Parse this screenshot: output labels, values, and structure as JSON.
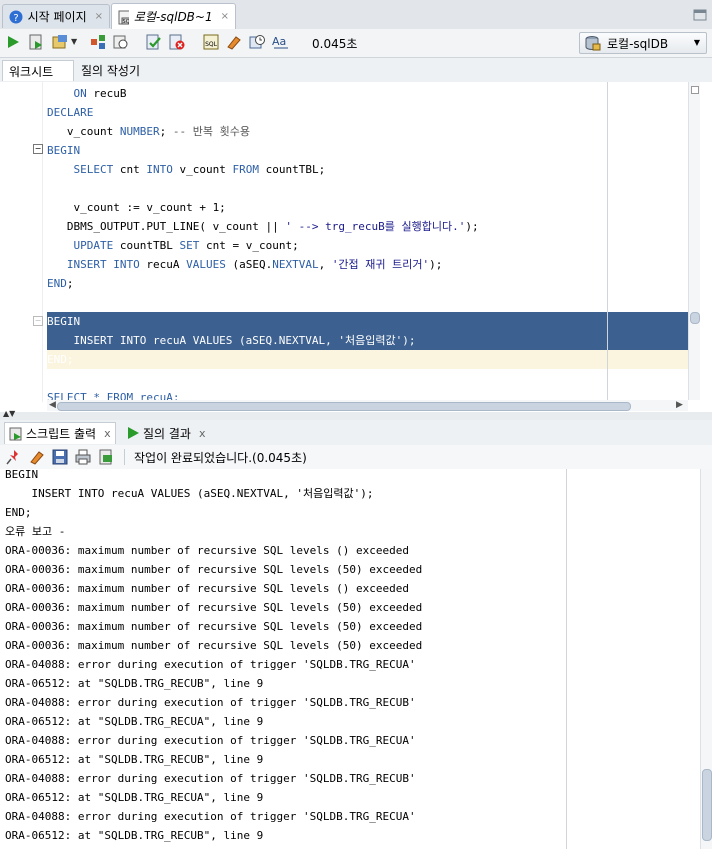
{
  "tabs": [
    {
      "label": "시작 페이지",
      "close": "×",
      "icon": "help-icon"
    },
    {
      "label": "로컬-sqlDB~1",
      "close": "×",
      "icon": "sql-worksheet-icon"
    }
  ],
  "toolbar": {
    "elapsed": "0.045초",
    "connection": "로컬-sqlDB",
    "icons": [
      "run-statement-icon",
      "run-script-icon",
      "autotrace-icon",
      "explain-plan-icon",
      "sql-tuning-icon",
      "commit-icon",
      "rollback-icon",
      "unshared-sql-icon",
      "clear-icon",
      "history-icon",
      "format-case-icon"
    ]
  },
  "worksheet_tabs": [
    "워크시트",
    "질의 작성기"
  ],
  "editor": {
    "lines": [
      [
        {
          "t": "    "
        },
        {
          "t": "ON",
          "c": "kw"
        },
        {
          "t": " recuB"
        }
      ],
      [
        {
          "t": "DECLARE",
          "c": "kw"
        }
      ],
      [
        {
          "t": "   v_count "
        },
        {
          "t": "NUMBER",
          "c": "kw"
        },
        {
          "t": "; "
        },
        {
          "t": "-- 반복 횟수용",
          "c": "cmt"
        }
      ],
      [
        {
          "t": "BEGIN",
          "c": "kw"
        }
      ],
      [
        {
          "t": "    "
        },
        {
          "t": "SELECT",
          "c": "kw"
        },
        {
          "t": " cnt "
        },
        {
          "t": "INTO",
          "c": "kw"
        },
        {
          "t": " v_count "
        },
        {
          "t": "FROM",
          "c": "kw"
        },
        {
          "t": " countTBL;"
        }
      ],
      [
        {
          "t": ""
        }
      ],
      [
        {
          "t": "    v_count := v_count + 1;"
        }
      ],
      [
        {
          "t": "   DBMS_OUTPUT.PUT_LINE( v_count || "
        },
        {
          "t": "' --> trg_recuB를 실행합니다.'",
          "c": "str"
        },
        {
          "t": ");"
        }
      ],
      [
        {
          "t": "    "
        },
        {
          "t": "UPDATE",
          "c": "kw"
        },
        {
          "t": " countTBL "
        },
        {
          "t": "SET",
          "c": "kw"
        },
        {
          "t": " cnt = v_count;"
        }
      ],
      [
        {
          "t": "   "
        },
        {
          "t": "INSERT INTO",
          "c": "kw"
        },
        {
          "t": " recuA "
        },
        {
          "t": "VALUES",
          "c": "kw"
        },
        {
          "t": " (aSEQ."
        },
        {
          "t": "NEXTVAL",
          "c": "kw"
        },
        {
          "t": ", "
        },
        {
          "t": "'간접 재귀 트리거'",
          "c": "str"
        },
        {
          "t": ");"
        }
      ],
      [
        {
          "t": "END",
          "c": "kw"
        },
        {
          "t": ";"
        }
      ],
      [
        {
          "t": ""
        }
      ],
      [
        {
          "t": "BEGIN"
        }
      ],
      [
        {
          "t": "    INSERT INTO recuA VALUES (aSEQ.NEXTVAL, '처음입력값');"
        }
      ],
      [
        {
          "t": "END;"
        }
      ],
      [
        {
          "t": ""
        }
      ],
      [
        {
          "t": "SELECT * FROM recuA;",
          "c": "kw"
        }
      ]
    ]
  },
  "output_tabs": [
    {
      "label": "스크립트 출력",
      "close": "x"
    },
    {
      "label": "질의 결과",
      "close": "x"
    }
  ],
  "output_status": "작업이 완료되었습니다.(0.045초)",
  "output": {
    "lines": [
      "BEGIN",
      "    INSERT INTO recuA VALUES (aSEQ.NEXTVAL, '처음입력값');",
      "END;",
      "오류 보고 -",
      "ORA-00036: maximum number of recursive SQL levels () exceeded",
      "ORA-00036: maximum number of recursive SQL levels (50) exceeded",
      "ORA-00036: maximum number of recursive SQL levels () exceeded",
      "ORA-00036: maximum number of recursive SQL levels (50) exceeded",
      "ORA-00036: maximum number of recursive SQL levels (50) exceeded",
      "ORA-00036: maximum number of recursive SQL levels (50) exceeded",
      "ORA-04088: error during execution of trigger 'SQLDB.TRG_RECUA'",
      "ORA-06512: at \"SQLDB.TRG_RECUB\", line 9",
      "ORA-04088: error during execution of trigger 'SQLDB.TRG_RECUB'",
      "ORA-06512: at \"SQLDB.TRG_RECUA\", line 9",
      "ORA-04088: error during execution of trigger 'SQLDB.TRG_RECUA'",
      "ORA-06512: at \"SQLDB.TRG_RECUB\", line 9",
      "ORA-04088: error during execution of trigger 'SQLDB.TRG_RECUB'",
      "ORA-06512: at \"SQLDB.TRG_RECUA\", line 9",
      "ORA-04088: error during execution of trigger 'SQLDB.TRG_RECUA'",
      "ORA-06512: at \"SQLDB.TRG_RECUB\", line 9"
    ]
  },
  "colors": {
    "keyword": "#2d5fa6",
    "selection": "#3c6090",
    "current_line": "#fbf5df"
  }
}
